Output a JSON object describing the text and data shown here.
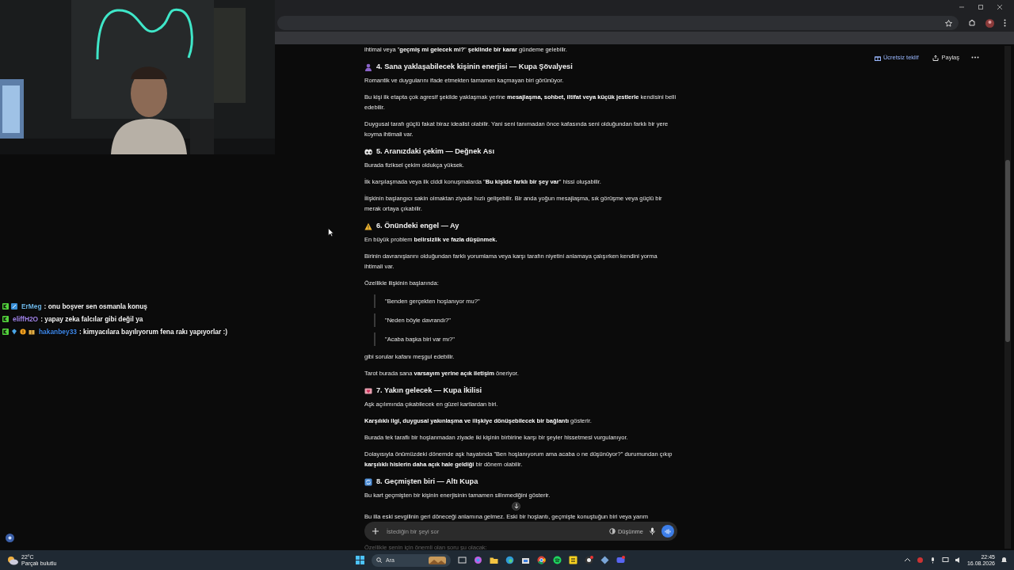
{
  "header": {
    "actions": [
      {
        "kind": "offer",
        "label": "Ücretsiz teklif"
      },
      {
        "kind": "share",
        "label": "Paylaş"
      },
      {
        "kind": "more"
      }
    ]
  },
  "blocks": [
    {
      "kind": "paragraph",
      "text": "ihtimal veya \"**geçmiş mi gelecek mi?**\" **şeklinde bir karar** gündeme gelebilir."
    },
    {
      "kind": "heading",
      "text": "4. Sana yaklaşabilecek kişinin enerjisi — Kupa Şövalyesi"
    },
    {
      "kind": "paragraph",
      "text": "Romantik ve duygularını ifade etmekten tamamen kaçmayan biri görünüyor."
    },
    {
      "kind": "paragraph",
      "text": "Bu kişi ilk etapta çok agresif şekilde yaklaşmak yerine **mesajlaşma, sohbet, iltifat veya küçük jestlerle** kendisini belli edebilir."
    },
    {
      "kind": "paragraph",
      "text": "Duygusal tarafı güçlü fakat biraz idealist olabilir. Yani seni tanımadan önce kafasında seni olduğundan farklı bir yere koyma ihtimali var."
    },
    {
      "kind": "heading",
      "text": "5. Aranızdaki çekim — Değnek Ası"
    },
    {
      "kind": "paragraph",
      "text": "Burada fiziksel çekim oldukça yüksek."
    },
    {
      "kind": "paragraph",
      "text": "İlk karşılaşmada veya ilk ciddi konuşmalarda \"**Bu kişide farklı bir şey var**\" hissi oluşabilir."
    },
    {
      "kind": "paragraph",
      "text": "İlişkinin başlangıcı sakin olmaktan ziyade hızlı gelişebilir. Bir anda yoğun mesajlaşma, sık görüşme veya güçlü bir merak ortaya çıkabilir."
    },
    {
      "kind": "heading",
      "text": "6. Önündeki engel — Ay"
    },
    {
      "kind": "paragraph",
      "text": "En büyük problem **belirsizlik ve fazla düşünmek.**"
    },
    {
      "kind": "paragraph",
      "text": "Birinin davranışlarını olduğundan farklı yorumlama veya karşı tarafın niyetini anlamaya çalışırken kendini yorma ihtimali var."
    },
    {
      "kind": "paragraph",
      "text": "Özellikle ilişkinin başlarında:"
    },
    {
      "kind": "quote",
      "text": "\"Benden gerçekten hoşlanıyor mu?\""
    },
    {
      "kind": "quote",
      "text": "\"Neden böyle davrandı?\""
    },
    {
      "kind": "quote",
      "text": "\"Acaba başka biri var mı?\""
    },
    {
      "kind": "paragraph",
      "text": "gibi sorular kafanı meşgul edebilir."
    },
    {
      "kind": "paragraph",
      "text": "Tarot burada sana **varsayım yerine açık iletişim** öneriyor."
    },
    {
      "kind": "heading",
      "text": "7. Yakın gelecek — Kupa İkilisi"
    },
    {
      "kind": "paragraph",
      "text": "Aşk açılımında çıkabilecek en güzel kartlardan biri."
    },
    {
      "kind": "paragraph",
      "text": "**Karşılıklı ilgi, duygusal yakınlaşma ve ilişkiye dönüşebilecek bir bağlantı** gösterir."
    },
    {
      "kind": "paragraph",
      "text": "Burada tek taraflı bir hoşlanmadan ziyade iki kişinin birbirine karşı bir şeyler hissetmesi vurgulanıyor."
    },
    {
      "kind": "paragraph",
      "text": "Dolayısıyla önümüzdeki dönemde aşk hayatında \"Ben hoşlanıyorum ama acaba o ne düşünüyor?\" durumundan çıkıp **karşılıklı hislerin daha açık hale geldiği** bir dönem olabilir."
    },
    {
      "kind": "heading",
      "text": "8. Geçmişten biri — Altı Kupa"
    },
    {
      "kind": "paragraph",
      "text": "Bu kart geçmişten bir kişinin enerjisinin tamamen silinmediğini gösterir."
    },
    {
      "kind": "cutline",
      "text": "Bu illa eski sevgilinin geri döneceği anlamına gelmez. Eski bir hoşlantı, geçmişte konuştuğun biri veya yarım"
    }
  ],
  "composer": {
    "placeholder": "İstediğin bir şeyi sor",
    "mode": "Düşünme"
  },
  "below_composer": [
    "Özellikle senin için önemli olan soru şu olacak:"
  ],
  "chat": [
    {
      "user": "ErMeg",
      "color": "#6cb4e4",
      "text": ": onu boşver sen osmanla konuş",
      "badges": [
        {
          "kind": "kick"
        },
        {
          "kind": "box"
        }
      ]
    },
    {
      "user": "eliffH2O",
      "color": "#a184e8",
      "text": ": yapay zeka falcılar gibi değil ya",
      "badges": [
        {
          "kind": "kick"
        }
      ]
    },
    {
      "user": "hakanbey33",
      "color": "#3d86e6",
      "text": ": kimyacılara bayılıyorum fena rakı yapıyorlar :)",
      "badges": [
        {
          "kind": "kick"
        },
        {
          "kind": "gem"
        },
        {
          "kind": "coin"
        },
        {
          "kind": "gift"
        }
      ]
    }
  ],
  "taskbar": {
    "temp": "22°C",
    "weather": "Parçalı bulutlu",
    "search": "Ara",
    "time": "22:45",
    "date": "16.08.2026"
  }
}
